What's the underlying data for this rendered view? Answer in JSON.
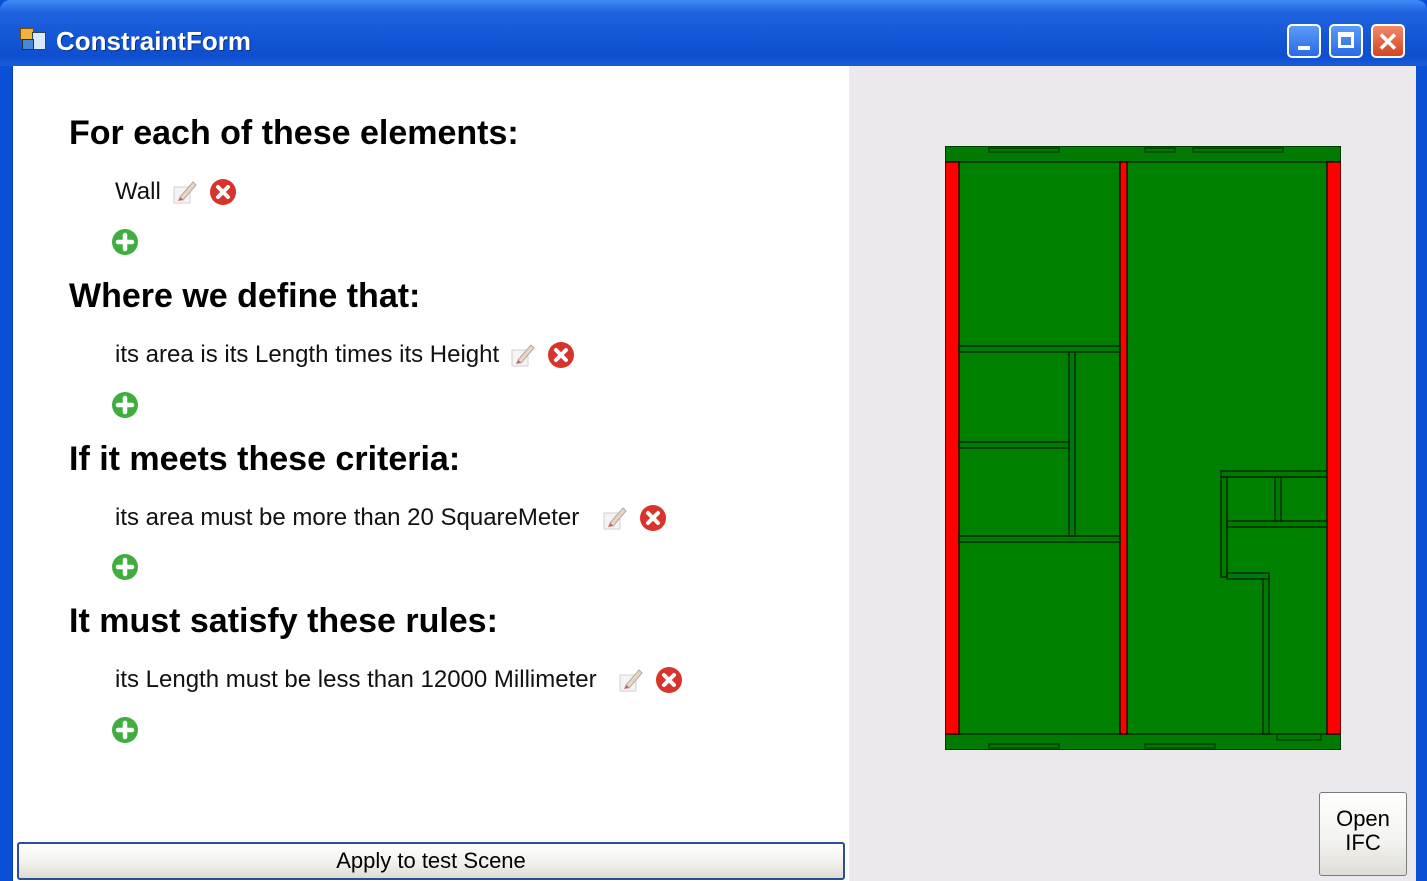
{
  "window": {
    "title": "ConstraintForm"
  },
  "sections": [
    {
      "heading": "For each of these elements:",
      "items": [
        "Wall"
      ]
    },
    {
      "heading": "Where we define that:",
      "items": [
        "its area is its Length times its Height"
      ]
    },
    {
      "heading": "If it meets these criteria:",
      "items": [
        "its area must be more than 20 SquareMeter"
      ]
    },
    {
      "heading": "It must satisfy these rules:",
      "items": [
        "its Length must be less than 12000 Millimeter"
      ]
    }
  ],
  "buttons": {
    "apply": "Apply to test Scene",
    "open_line1": "Open",
    "open_line2": "IFC"
  },
  "icons": {
    "edit": "pencil-edit-icon",
    "delete": "red-x-delete-icon",
    "add": "green-plus-add-icon",
    "app": "form-app-icon"
  },
  "colors": {
    "titlebar": "#1457d6",
    "passing_wall": "#008000",
    "failing_wall": "#ff0000",
    "delete": "#d9342b",
    "add": "#3fae3f",
    "right_panel": "#ebe9ed"
  }
}
